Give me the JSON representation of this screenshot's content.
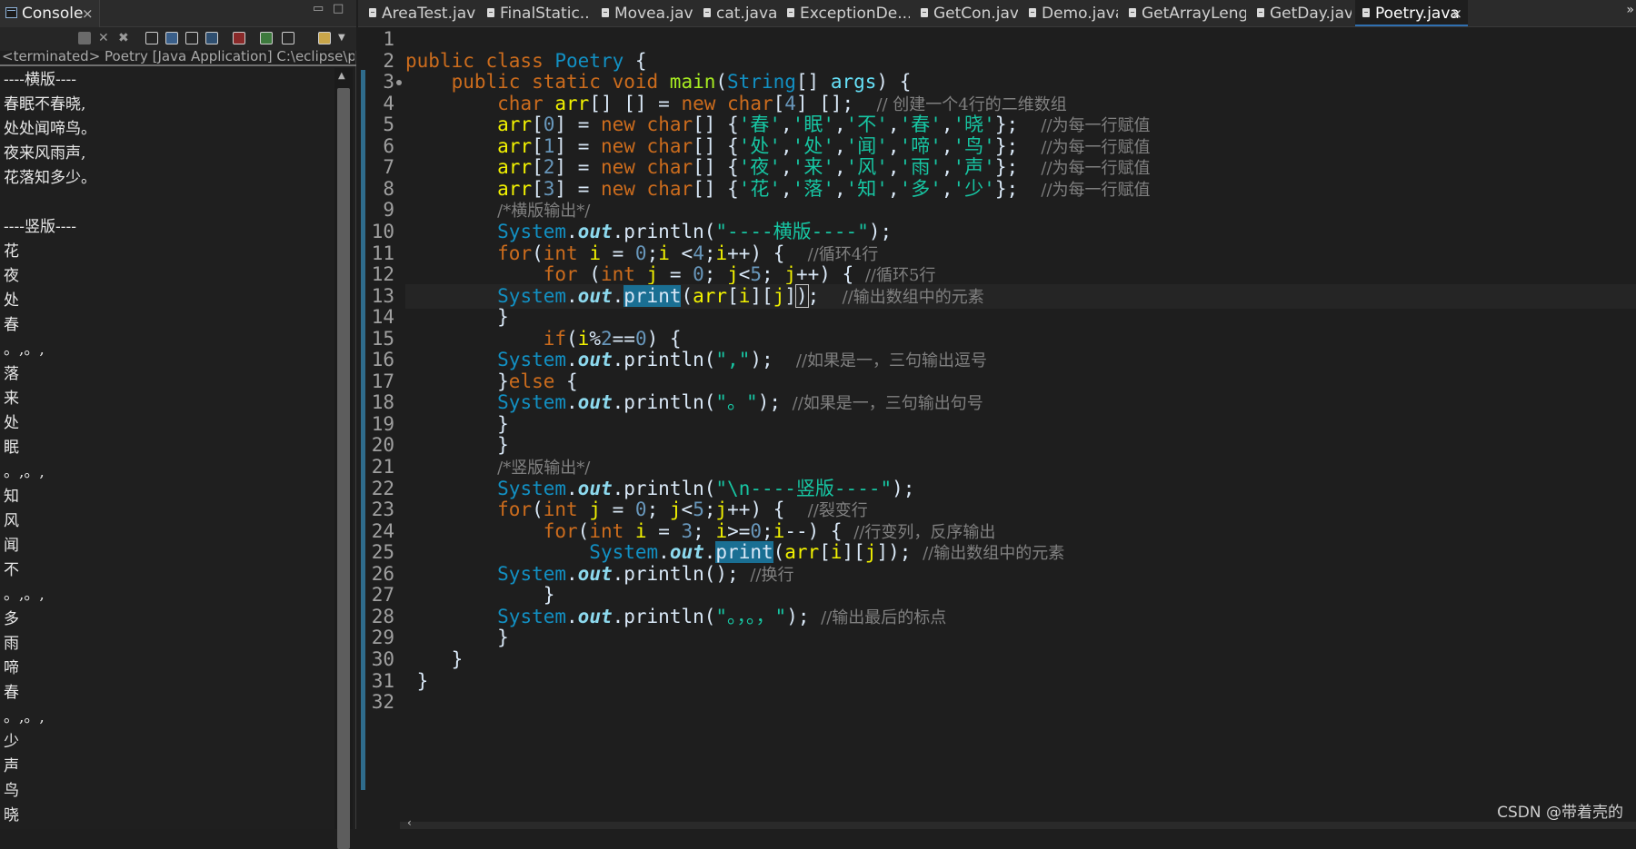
{
  "console": {
    "tab_label": "Console",
    "close_glyph": "×",
    "minimize_glyph": "▭",
    "maximize_glyph": "□",
    "status": "<terminated> Poetry [Java Application] C:\\eclipse\\plu",
    "output_lines": [
      "----横版----",
      "春眠不春晓,",
      "处处闻啼鸟。",
      "夜来风雨声,",
      "花落知多少。",
      "",
      "----竖版----",
      "花",
      "夜",
      "处",
      "春",
      "。,。,",
      "落",
      "来",
      "处",
      "眠",
      "。,。,",
      "知",
      "风",
      "闻",
      "不",
      "。,。,",
      "多",
      "雨",
      "啼",
      "春",
      "。,。,",
      "少",
      "声",
      "鸟",
      "晓"
    ],
    "toolbar_icons": [
      "terminate-icon",
      "remove-launch-icon",
      "remove-all-icon",
      "scroll-lock-icon",
      "word-wrap-icon",
      "show-stdout-icon",
      "show-stderr-icon",
      "pin-console-icon",
      "display-console-icon",
      "open-console-icon"
    ]
  },
  "editor": {
    "tabs": [
      {
        "label": "AreaTest.java",
        "active": false
      },
      {
        "label": "FinalStatic...",
        "active": false
      },
      {
        "label": "Movea.java",
        "active": false
      },
      {
        "label": "cat.java",
        "active": false
      },
      {
        "label": "ExceptionDe...",
        "active": false
      },
      {
        "label": "GetCon.java",
        "active": false
      },
      {
        "label": "Demo.java",
        "active": false
      },
      {
        "label": "GetArrayLeng...",
        "active": false
      },
      {
        "label": "GetDay.java",
        "active": false
      },
      {
        "label": "Poetry.java",
        "active": true
      }
    ],
    "overflow_glyph": "»",
    "close_glyph": "×",
    "current_line": 13,
    "code_lines": [
      [],
      [
        [
          "kw",
          "public class "
        ],
        [
          "ty",
          "Poetry"
        ],
        [
          "pl",
          " {"
        ]
      ],
      [
        [
          "pl",
          "    "
        ],
        [
          "kw",
          "public static void "
        ],
        [
          "mt",
          "main"
        ],
        [
          "pl",
          "("
        ],
        [
          "ty",
          "String"
        ],
        [
          "pl",
          "[] "
        ],
        [
          "va",
          "args"
        ],
        [
          "pl",
          ") {"
        ]
      ],
      [
        [
          "pl",
          "        "
        ],
        [
          "kw",
          "char "
        ],
        [
          "lv",
          "arr"
        ],
        [
          "pl",
          "[] [] = "
        ],
        [
          "kw",
          "new char"
        ],
        [
          "pl",
          "["
        ],
        [
          "nm",
          "4"
        ],
        [
          "pl",
          "] [];  "
        ],
        [
          "cm",
          "// 创建一个4行的二维数组"
        ]
      ],
      [
        [
          "pl",
          "        "
        ],
        [
          "lv",
          "arr"
        ],
        [
          "pl",
          "["
        ],
        [
          "nm",
          "0"
        ],
        [
          "pl",
          "] = "
        ],
        [
          "kw",
          "new char"
        ],
        [
          "pl",
          "[] {"
        ],
        [
          "st",
          "'春'"
        ],
        [
          "pl",
          ","
        ],
        [
          "st",
          "'眠'"
        ],
        [
          "pl",
          ","
        ],
        [
          "st",
          "'不'"
        ],
        [
          "pl",
          ","
        ],
        [
          "st",
          "'春'"
        ],
        [
          "pl",
          ","
        ],
        [
          "st",
          "'晓'"
        ],
        [
          "pl",
          "};  "
        ],
        [
          "cm",
          "//为每一行赋值"
        ]
      ],
      [
        [
          "pl",
          "        "
        ],
        [
          "lv",
          "arr"
        ],
        [
          "pl",
          "["
        ],
        [
          "nm",
          "1"
        ],
        [
          "pl",
          "] = "
        ],
        [
          "kw",
          "new char"
        ],
        [
          "pl",
          "[] {"
        ],
        [
          "st",
          "'处'"
        ],
        [
          "pl",
          ","
        ],
        [
          "st",
          "'处'"
        ],
        [
          "pl",
          ","
        ],
        [
          "st",
          "'闻'"
        ],
        [
          "pl",
          ","
        ],
        [
          "st",
          "'啼'"
        ],
        [
          "pl",
          ","
        ],
        [
          "st",
          "'鸟'"
        ],
        [
          "pl",
          "};  "
        ],
        [
          "cm",
          "//为每一行赋值"
        ]
      ],
      [
        [
          "pl",
          "        "
        ],
        [
          "lv",
          "arr"
        ],
        [
          "pl",
          "["
        ],
        [
          "nm",
          "2"
        ],
        [
          "pl",
          "] = "
        ],
        [
          "kw",
          "new char"
        ],
        [
          "pl",
          "[] {"
        ],
        [
          "st",
          "'夜'"
        ],
        [
          "pl",
          ","
        ],
        [
          "st",
          "'来'"
        ],
        [
          "pl",
          ","
        ],
        [
          "st",
          "'风'"
        ],
        [
          "pl",
          ","
        ],
        [
          "st",
          "'雨'"
        ],
        [
          "pl",
          ","
        ],
        [
          "st",
          "'声'"
        ],
        [
          "pl",
          "};  "
        ],
        [
          "cm",
          "//为每一行赋值"
        ]
      ],
      [
        [
          "pl",
          "        "
        ],
        [
          "lv",
          "arr"
        ],
        [
          "pl",
          "["
        ],
        [
          "nm",
          "3"
        ],
        [
          "pl",
          "] = "
        ],
        [
          "kw",
          "new char"
        ],
        [
          "pl",
          "[] {"
        ],
        [
          "st",
          "'花'"
        ],
        [
          "pl",
          ","
        ],
        [
          "st",
          "'落'"
        ],
        [
          "pl",
          ","
        ],
        [
          "st",
          "'知'"
        ],
        [
          "pl",
          ","
        ],
        [
          "st",
          "'多'"
        ],
        [
          "pl",
          ","
        ],
        [
          "st",
          "'少'"
        ],
        [
          "pl",
          "};  "
        ],
        [
          "cm",
          "//为每一行赋值"
        ]
      ],
      [
        [
          "pl",
          "        "
        ],
        [
          "cm",
          "/*横版输出*/"
        ]
      ],
      [
        [
          "pl",
          "        "
        ],
        [
          "ty",
          "System"
        ],
        [
          "pl",
          "."
        ],
        [
          "fd",
          "out"
        ],
        [
          "pl",
          ".println("
        ],
        [
          "st",
          "\"----横版----\""
        ],
        [
          "pl",
          ");"
        ]
      ],
      [
        [
          "pl",
          "        "
        ],
        [
          "kw",
          "for"
        ],
        [
          "pl",
          "("
        ],
        [
          "kw",
          "int "
        ],
        [
          "lv",
          "i"
        ],
        [
          "pl",
          " = "
        ],
        [
          "nm",
          "0"
        ],
        [
          "pl",
          ";"
        ],
        [
          "lv",
          "i"
        ],
        [
          "pl",
          " <"
        ],
        [
          "nm",
          "4"
        ],
        [
          "pl",
          ";"
        ],
        [
          "lv",
          "i"
        ],
        [
          "pl",
          "++) {  "
        ],
        [
          "cm",
          "//循环4行"
        ]
      ],
      [
        [
          "pl",
          "            "
        ],
        [
          "kw",
          "for"
        ],
        [
          "pl",
          " ("
        ],
        [
          "kw",
          "int "
        ],
        [
          "lv",
          "j"
        ],
        [
          "pl",
          " = "
        ],
        [
          "nm",
          "0"
        ],
        [
          "pl",
          "; "
        ],
        [
          "lv",
          "j"
        ],
        [
          "pl",
          "<"
        ],
        [
          "nm",
          "5"
        ],
        [
          "pl",
          "; "
        ],
        [
          "lv",
          "j"
        ],
        [
          "pl",
          "++) { "
        ],
        [
          "cm",
          "//循环5行"
        ]
      ],
      [
        [
          "pl",
          "        "
        ],
        [
          "ty",
          "System"
        ],
        [
          "pl",
          "."
        ],
        [
          "fd",
          "out"
        ],
        [
          "pl",
          "."
        ],
        [
          "hl",
          "print"
        ],
        [
          "pl",
          "("
        ],
        [
          "lv",
          "arr"
        ],
        [
          "pl",
          "["
        ],
        [
          "lv",
          "i"
        ],
        [
          "pl",
          "]["
        ],
        [
          "lv",
          "j"
        ],
        [
          "pl",
          "]"
        ],
        [
          "br",
          ")"
        ],
        [
          "pl",
          ";  "
        ],
        [
          "cm",
          "//输出数组中的元素"
        ]
      ],
      [
        [
          "pl",
          "        }"
        ]
      ],
      [
        [
          "pl",
          "            "
        ],
        [
          "kw",
          "if"
        ],
        [
          "pl",
          "("
        ],
        [
          "lv",
          "i"
        ],
        [
          "pl",
          "%"
        ],
        [
          "nm",
          "2"
        ],
        [
          "pl",
          "=="
        ],
        [
          "nm",
          "0"
        ],
        [
          "pl",
          ") {"
        ]
      ],
      [
        [
          "pl",
          "        "
        ],
        [
          "ty",
          "System"
        ],
        [
          "pl",
          "."
        ],
        [
          "fd",
          "out"
        ],
        [
          "pl",
          ".println("
        ],
        [
          "st",
          "\",\""
        ],
        [
          "pl",
          ");  "
        ],
        [
          "cm",
          "//如果是一，三句输出逗号"
        ]
      ],
      [
        [
          "pl",
          "        }"
        ],
        [
          "kw",
          "else"
        ],
        [
          "pl",
          " {"
        ]
      ],
      [
        [
          "pl",
          "        "
        ],
        [
          "ty",
          "System"
        ],
        [
          "pl",
          "."
        ],
        [
          "fd",
          "out"
        ],
        [
          "pl",
          ".println("
        ],
        [
          "st",
          "\"。\""
        ],
        [
          "pl",
          "); "
        ],
        [
          "cm",
          "//如果是一，三句输出句号"
        ]
      ],
      [
        [
          "pl",
          "        }"
        ]
      ],
      [
        [
          "pl",
          "        }"
        ]
      ],
      [
        [
          "pl",
          "        "
        ],
        [
          "cm",
          "/*竖版输出*/"
        ]
      ],
      [
        [
          "pl",
          "        "
        ],
        [
          "ty",
          "System"
        ],
        [
          "pl",
          "."
        ],
        [
          "fd",
          "out"
        ],
        [
          "pl",
          ".println("
        ],
        [
          "st",
          "\"\\n----竖版----\""
        ],
        [
          "pl",
          ");"
        ]
      ],
      [
        [
          "pl",
          "        "
        ],
        [
          "kw",
          "for"
        ],
        [
          "pl",
          "("
        ],
        [
          "kw",
          "int "
        ],
        [
          "lv",
          "j"
        ],
        [
          "pl",
          " = "
        ],
        [
          "nm",
          "0"
        ],
        [
          "pl",
          "; "
        ],
        [
          "lv",
          "j"
        ],
        [
          "pl",
          "<"
        ],
        [
          "nm",
          "5"
        ],
        [
          "pl",
          ";"
        ],
        [
          "lv",
          "j"
        ],
        [
          "pl",
          "++) {  "
        ],
        [
          "cm",
          "//裂变行"
        ]
      ],
      [
        [
          "pl",
          "            "
        ],
        [
          "kw",
          "for"
        ],
        [
          "pl",
          "("
        ],
        [
          "kw",
          "int "
        ],
        [
          "lv",
          "i"
        ],
        [
          "pl",
          " = "
        ],
        [
          "nm",
          "3"
        ],
        [
          "pl",
          "; "
        ],
        [
          "lv",
          "i"
        ],
        [
          "pl",
          ">="
        ],
        [
          "nm",
          "0"
        ],
        [
          "pl",
          ";"
        ],
        [
          "lv",
          "i"
        ],
        [
          "pl",
          "--) { "
        ],
        [
          "cm",
          "//行变列，反序输出"
        ]
      ],
      [
        [
          "pl",
          "                "
        ],
        [
          "ty",
          "System"
        ],
        [
          "pl",
          "."
        ],
        [
          "fd",
          "out"
        ],
        [
          "pl",
          "."
        ],
        [
          "hl",
          "print"
        ],
        [
          "pl",
          "("
        ],
        [
          "lv",
          "arr"
        ],
        [
          "pl",
          "["
        ],
        [
          "lv",
          "i"
        ],
        [
          "pl",
          "]["
        ],
        [
          "lv",
          "j"
        ],
        [
          "pl",
          "]); "
        ],
        [
          "cm",
          "//输出数组中的元素"
        ]
      ],
      [
        [
          "pl",
          "        "
        ],
        [
          "ty",
          "System"
        ],
        [
          "pl",
          "."
        ],
        [
          "fd",
          "out"
        ],
        [
          "pl",
          ".println(); "
        ],
        [
          "cm",
          "//换行"
        ]
      ],
      [
        [
          "pl",
          "            }"
        ]
      ],
      [
        [
          "pl",
          "        "
        ],
        [
          "ty",
          "System"
        ],
        [
          "pl",
          "."
        ],
        [
          "fd",
          "out"
        ],
        [
          "pl",
          ".println("
        ],
        [
          "st",
          "\"。，。，\""
        ],
        [
          "pl",
          "); "
        ],
        [
          "cm",
          "//输出最后的标点"
        ]
      ],
      [
        [
          "pl",
          "        }"
        ]
      ],
      [
        [
          "pl",
          "    }"
        ]
      ],
      [
        [
          "pl",
          " }"
        ]
      ],
      []
    ]
  },
  "watermark": "CSDN @带着壳的",
  "colors": {
    "keyword": "#cc6c1d",
    "type": "#1290c3",
    "method": "#a7ec21",
    "string": "#17c6a3",
    "number": "#6897bb",
    "comment": "#808080",
    "local_var": "#f2f200",
    "field": "#8dd9ee",
    "highlight": "#1a6f93"
  }
}
